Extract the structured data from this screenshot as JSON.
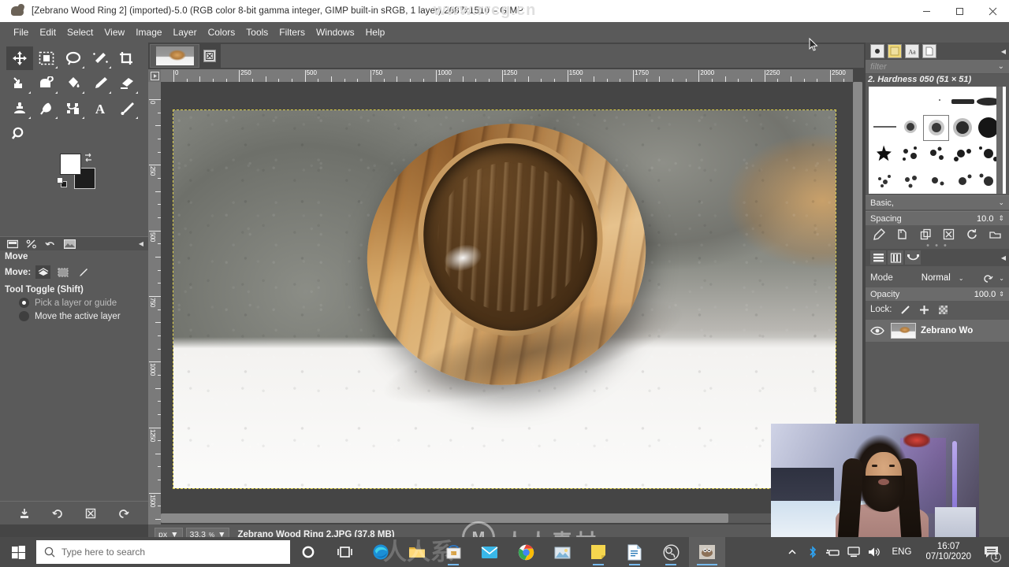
{
  "titlebar": {
    "title": "[Zebrano Wood Ring 2] (imported)-5.0 (RGB color 8-bit gamma integer, GIMP built-in sRGB, 1 layer) 2687x1510 – GIMP",
    "minimize": "minimize-icon",
    "maximize": "maximize-icon",
    "close": "close-icon",
    "watermark": "www.rrcg.cn"
  },
  "menubar": {
    "items": [
      {
        "label": "File"
      },
      {
        "label": "Edit"
      },
      {
        "label": "Select"
      },
      {
        "label": "View"
      },
      {
        "label": "Image"
      },
      {
        "label": "Layer"
      },
      {
        "label": "Colors"
      },
      {
        "label": "Tools"
      },
      {
        "label": "Filters"
      },
      {
        "label": "Windows"
      },
      {
        "label": "Help"
      }
    ]
  },
  "toolbox": {
    "tools": [
      {
        "name": "move-tool",
        "active": true
      },
      {
        "name": "rectangle-select-tool",
        "active": false
      },
      {
        "name": "free-select-tool",
        "active": false
      },
      {
        "name": "fuzzy-select-tool",
        "active": false
      },
      {
        "name": "crop-tool",
        "active": false
      },
      {
        "name": "transform-tool",
        "active": false
      },
      {
        "name": "warp-transform-tool",
        "active": false
      },
      {
        "name": "bucket-fill-tool",
        "active": false
      },
      {
        "name": "paintbrush-tool",
        "active": false
      },
      {
        "name": "eraser-tool",
        "active": false
      },
      {
        "name": "clone-tool",
        "active": false
      },
      {
        "name": "smudge-tool",
        "active": false
      },
      {
        "name": "paths-tool",
        "active": false
      },
      {
        "name": "text-tool",
        "active": false
      },
      {
        "name": "color-picker-tool",
        "active": false
      },
      {
        "name": "zoom-tool",
        "active": false
      }
    ],
    "foreground_color": "#ffffff",
    "background_color": "#1d1d1d"
  },
  "tool_options": {
    "title": "Move",
    "move_label": "Move:",
    "toggle_label": "Tool Toggle  (Shift)",
    "options": [
      {
        "label": "Pick a layer or guide",
        "selected": true
      },
      {
        "label": "Move the active layer",
        "selected": false
      }
    ],
    "bottom_icons": [
      "save-tool-preset-icon",
      "restore-tool-preset-icon",
      "delete-tool-preset-icon",
      "reset-tool-options-icon"
    ]
  },
  "image_window": {
    "tab_thumb": "image-thumbnail",
    "close_tab": "close-tab-icon",
    "h_ruler_labels": [
      "0",
      "250",
      "500",
      "750",
      "1000",
      "1250",
      "1500",
      "1750",
      "2000",
      "2250",
      "2500"
    ],
    "v_ruler_labels": [
      "0",
      "250",
      "500",
      "750",
      "1000",
      "1250",
      "1500"
    ],
    "image_alt": "Zebrano wood ring resting against grey pebbles on a white surface"
  },
  "statusbar": {
    "unit": "px",
    "zoom": "33.3",
    "zoom_suffix": "%",
    "text": "Zebrano Wood Ring 2.JPG (37.8 MB)",
    "watermark_cn": "人人素材"
  },
  "dock": {
    "tabs": [
      "brushes-tab",
      "patterns-tab",
      "fonts-tab",
      "document-history-tab"
    ],
    "filter_placeholder": "filter",
    "brush_name": "2. Hardness 050 (51 × 51)",
    "brush_set": "Basic,",
    "spacing_label": "Spacing",
    "spacing_value": "10.0",
    "brush_action_icons": [
      "edit-brush-icon",
      "new-brush-icon",
      "duplicate-brush-icon",
      "delete-brush-icon",
      "refresh-brushes-icon",
      "open-brush-folder-icon"
    ],
    "layer_tabs": [
      "layers-tab",
      "channels-tab",
      "paths-tab"
    ],
    "mode_label": "Mode",
    "mode_value": "Normal",
    "opacity_label": "Opacity",
    "opacity_value": "100.0",
    "lock_label": "Lock:",
    "lock_icons": [
      "lock-pixels-icon",
      "lock-position-icon",
      "lock-alpha-icon"
    ],
    "layers": [
      {
        "name": "Zebrano Wo",
        "visible": true
      }
    ]
  },
  "taskbar": {
    "start": "windows-start-icon",
    "search_placeholder": "Type here to search",
    "icons": [
      {
        "name": "cortana-icon"
      },
      {
        "name": "task-view-icon"
      },
      {
        "name": "microsoft-edge-icon"
      },
      {
        "name": "file-explorer-icon"
      },
      {
        "name": "microsoft-store-icon"
      },
      {
        "name": "mail-icon"
      },
      {
        "name": "google-chrome-icon"
      },
      {
        "name": "photos-icon"
      },
      {
        "name": "sticky-notes-icon"
      },
      {
        "name": "word-icon"
      },
      {
        "name": "obs-studio-icon"
      },
      {
        "name": "gimp-icon"
      }
    ],
    "tray": {
      "overflow": "show-hidden-icons-chevron",
      "bluetooth": "bluetooth-icon",
      "removable": "safely-remove-hardware-icon",
      "network": "network-icon",
      "volume": "volume-icon",
      "language": "ENG",
      "time": "16:07",
      "date": "07/10/2020",
      "notifications": "action-center-icon",
      "notification_count": "1"
    }
  }
}
